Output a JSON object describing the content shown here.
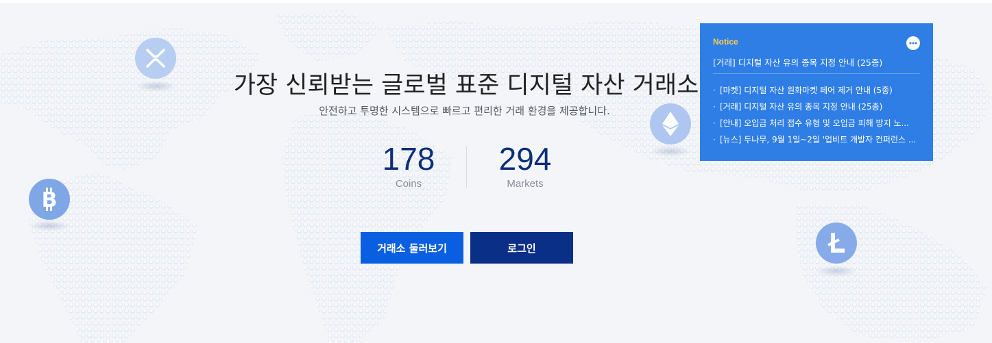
{
  "hero": {
    "title": "가장 신뢰받는 글로벌 표준 디지털 자산 거래소",
    "subtitle": "안전하고 투명한 시스템으로 빠르고 편리한 거래 환경을 제공합니다."
  },
  "stats": [
    {
      "value": "178",
      "label": "Coins"
    },
    {
      "value": "294",
      "label": "Markets"
    }
  ],
  "buttons": {
    "explore": "거래소 둘러보기",
    "login": "로그인"
  },
  "notice": {
    "label": "Notice",
    "more_icon": "more-dots-icon",
    "headline": "[거래] 디지털 자산 유의 종목 지정 안내 (25종)",
    "items": [
      "[마켓] 디지털 자산 원화마켓 페어 제거 안내 (5종)",
      "[거래] 디지털 자산 유의 종목 지정 안내 (25종)",
      "[안내] 오입금 처리 접수 유형 및 오입금 피해 방지 노...",
      "[뉴스] 두나무, 9월 1일~2일 '업비트 개발자 컨퍼런스 ..."
    ]
  },
  "colors": {
    "background": "#f3f5f9",
    "title": "#222222",
    "stat_number": "#0c2e7a",
    "explore_button": "#0a5ee0",
    "login_button": "#0a2f86",
    "notice_bg": "#2f7ee6",
    "notice_label": "#ffcf4a",
    "coin_badge": "#8fb2ea"
  },
  "coins": [
    "xrp-icon",
    "ethereum-icon",
    "bitcoin-icon",
    "litecoin-icon"
  ]
}
